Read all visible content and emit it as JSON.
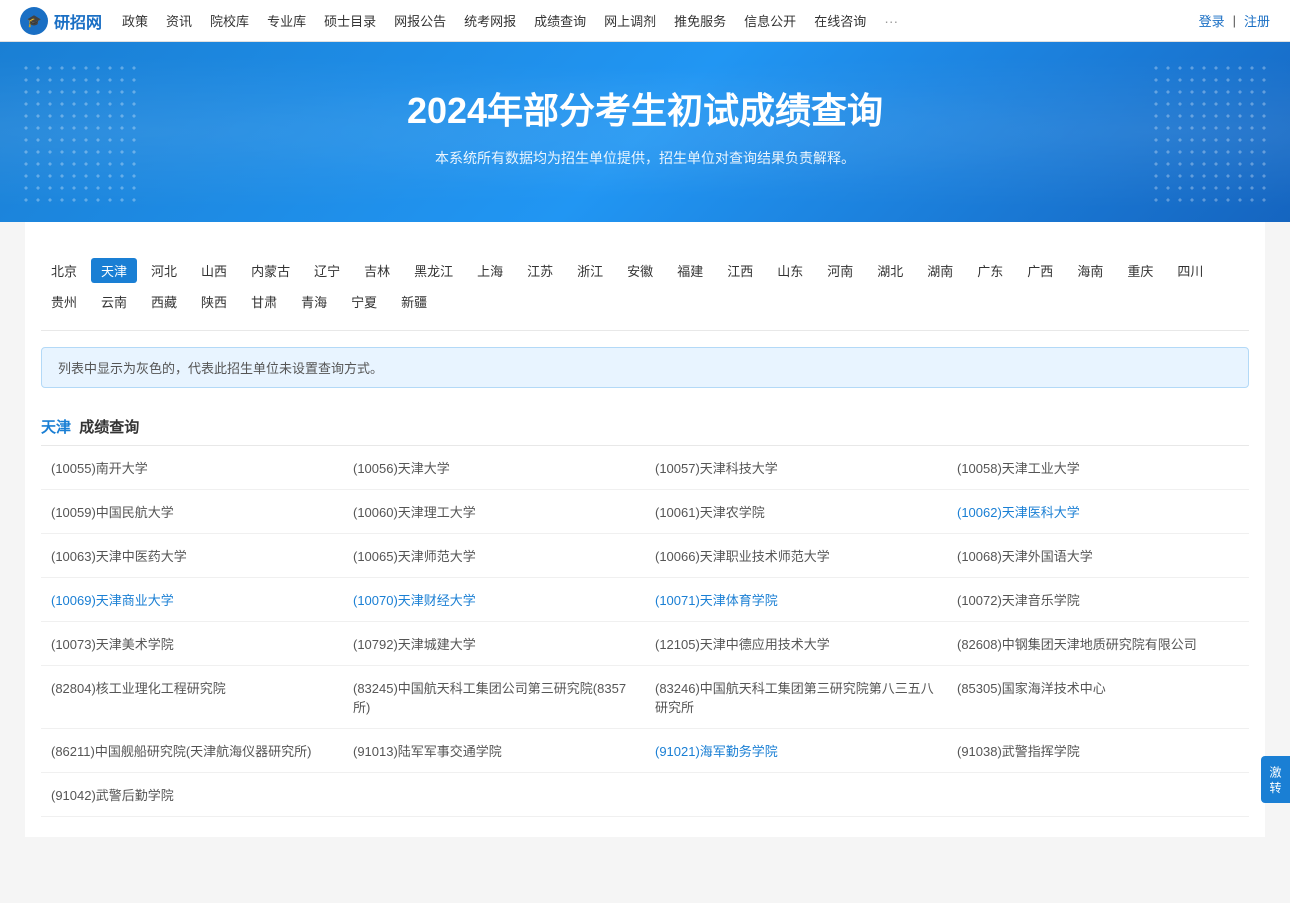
{
  "header": {
    "logo_text": "研招网",
    "logo_icon": "🎓",
    "nav_items": [
      "政策",
      "资讯",
      "院校库",
      "专业库",
      "硕士目录",
      "网报公告",
      "统考网报",
      "成绩查询",
      "网上调剂",
      "推免服务",
      "信息公开",
      "在线咨询",
      "···"
    ],
    "login": "登录",
    "separator": "|",
    "register": "注册"
  },
  "banner": {
    "title": "2024年部分考生初试成绩查询",
    "subtitle": "本系统所有数据均为招生单位提供，招生单位对查询结果负责解释。"
  },
  "provinces": {
    "row1": [
      "北京",
      "天津",
      "河北",
      "山西",
      "内蒙古",
      "辽宁",
      "吉林",
      "黑龙江",
      "上海",
      "江苏",
      "浙江",
      "安徽",
      "福建",
      "江西",
      "山东",
      "河南",
      "湖北",
      "湖南",
      "广东",
      "广西",
      "海南",
      "重庆",
      "四川"
    ],
    "row2": [
      "贵州",
      "云南",
      "西藏",
      "陕西",
      "甘肃",
      "青海",
      "宁夏",
      "新疆"
    ],
    "active": "天津"
  },
  "info_text": "列表中显示为灰色的，代表此招生单位未设置查询方式。",
  "section": {
    "region": "天津",
    "label": "成绩查询"
  },
  "universities": [
    [
      {
        "code": "10055",
        "name": "南开大学",
        "link": false
      },
      {
        "code": "10056",
        "name": "天津大学",
        "link": false
      },
      {
        "code": "10057",
        "name": "天津科技大学",
        "link": false
      },
      {
        "code": "10058",
        "name": "天津工业大学",
        "link": false
      }
    ],
    [
      {
        "code": "10059",
        "name": "中国民航大学",
        "link": false
      },
      {
        "code": "10060",
        "name": "天津理工大学",
        "link": false
      },
      {
        "code": "10061",
        "name": "天津农学院",
        "link": false
      },
      {
        "code": "10062",
        "name": "天津医科大学",
        "link": true
      }
    ],
    [
      {
        "code": "10063",
        "name": "天津中医药大学",
        "link": false
      },
      {
        "code": "10065",
        "name": "天津师范大学",
        "link": false
      },
      {
        "code": "10066",
        "name": "天津职业技术师范大学",
        "link": false
      },
      {
        "code": "10068",
        "name": "天津外国语大学",
        "link": false
      }
    ],
    [
      {
        "code": "10069",
        "name": "天津商业大学",
        "link": true
      },
      {
        "code": "10070",
        "name": "天津财经大学",
        "link": true
      },
      {
        "code": "10071",
        "name": "天津体育学院",
        "link": true
      },
      {
        "code": "10072",
        "name": "天津音乐学院",
        "link": false
      }
    ],
    [
      {
        "code": "10073",
        "name": "天津美术学院",
        "link": false
      },
      {
        "code": "10792",
        "name": "天津城建大学",
        "link": false
      },
      {
        "code": "12105",
        "name": "天津中德应用技术大学",
        "link": false
      },
      {
        "code": "82608",
        "name": "中钢集团天津地质研究院有限公司",
        "link": false
      }
    ],
    [
      {
        "code": "82804",
        "name": "核工业理化工程研究院",
        "link": false
      },
      {
        "code": "83245",
        "name": "中国航天科工集团公司第三研究院(8357所)",
        "link": false
      },
      {
        "code": "83246",
        "name": "中国航天科工集团第三研究院第八三五八研究所",
        "link": false
      },
      {
        "code": "85305",
        "name": "国家海洋技术中心",
        "link": false
      }
    ],
    [
      {
        "code": "86211",
        "name": "中国舰船研究院(天津航海仪器研究所)",
        "link": false
      },
      {
        "code": "91013",
        "name": "陆军军事交通学院",
        "link": false
      },
      {
        "code": "91021",
        "name": "海军勤务学院",
        "link": true
      },
      {
        "code": "91038",
        "name": "武警指挥学院",
        "link": false
      }
    ],
    [
      {
        "code": "91042",
        "name": "武警后勤学院",
        "link": false
      },
      {
        "code": "",
        "name": "",
        "link": false
      },
      {
        "code": "",
        "name": "",
        "link": false
      },
      {
        "code": "",
        "name": "",
        "link": false
      }
    ]
  ],
  "float_btn": "激\n转"
}
